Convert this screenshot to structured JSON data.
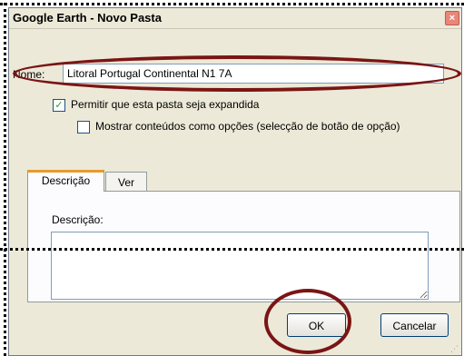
{
  "window": {
    "title": "Google Earth - Novo Pasta",
    "close_glyph": "×"
  },
  "name_field": {
    "label": "Nome:",
    "value": "Litoral Portugal Continental N1 7A"
  },
  "options": {
    "expand": {
      "label": "Permitir que esta pasta seja expandida",
      "checked": true,
      "mark": "✓"
    },
    "radio_contents": {
      "label": "Mostrar conteúdos como opções (selecção de botão de opção)",
      "checked": false
    }
  },
  "tabs": [
    {
      "label": "Descrição",
      "active": true
    },
    {
      "label": "Ver",
      "active": false
    }
  ],
  "description_panel": {
    "label": "Descrição:",
    "value": ""
  },
  "buttons": {
    "ok": "OK",
    "cancel": "Cancelar"
  },
  "colors": {
    "annotation": "#7a1515",
    "tab_accent": "#e69a2c",
    "check_mark": "#21a121"
  }
}
